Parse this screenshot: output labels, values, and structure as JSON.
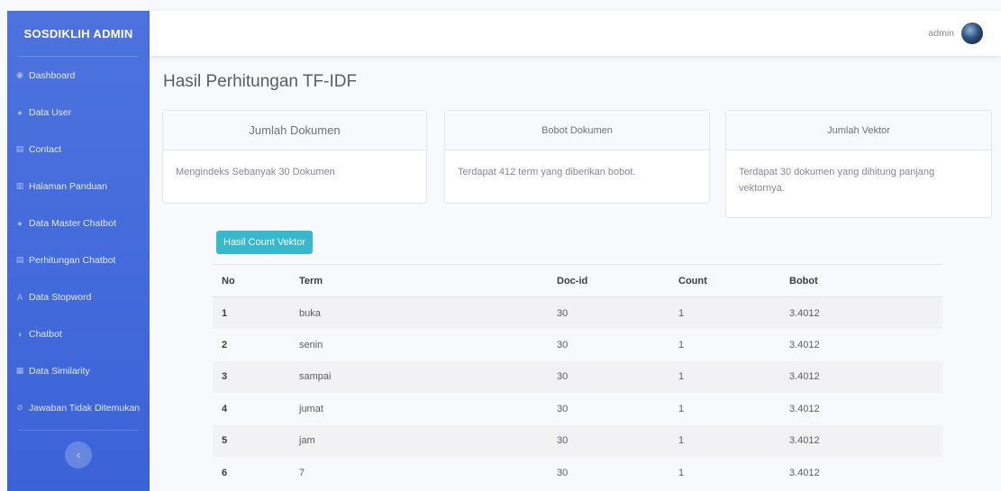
{
  "sidebar": {
    "brand": "SOSDIKLIH ADMIN",
    "items": [
      {
        "label": "Dashboard",
        "icon": "tachometer-icon",
        "glyph": "◉"
      },
      {
        "label": "Data User",
        "icon": "user-icon",
        "glyph": "●"
      },
      {
        "label": "Contact",
        "icon": "file-icon",
        "glyph": "▤"
      },
      {
        "label": "Halaman Panduan",
        "icon": "book-icon",
        "glyph": "▥"
      },
      {
        "label": "Data Master Chatbot",
        "icon": "comment-icon",
        "glyph": "●"
      },
      {
        "label": "Perhitungan Chatbot",
        "icon": "table-icon",
        "glyph": "▤"
      },
      {
        "label": "Data Stopword",
        "icon": "font-icon",
        "glyph": "A"
      },
      {
        "label": "Chatbot",
        "icon": "comments-icon",
        "glyph": "◖"
      },
      {
        "label": "Data Similarity",
        "icon": "table-icon",
        "glyph": "▦"
      },
      {
        "label": "Jawaban Tidak Ditemukan",
        "icon": "eye-slash-icon",
        "glyph": "⊘"
      }
    ],
    "toggle_glyph": "‹"
  },
  "topbar": {
    "user_name": "admin"
  },
  "page": {
    "title": "Hasil Perhitungan TF-IDF"
  },
  "cards": [
    {
      "header": "Jumlah Dokumen",
      "body": "Mengindeks Sebanyak 30 Dokumen"
    },
    {
      "header": "Bobot Dokumen",
      "body": "Terdapat 412 term yang diberikan bobot."
    },
    {
      "header": "Jumlah Vektor",
      "body": "Terdapat 30 dokumen yang dihitung panjang vektornya."
    }
  ],
  "button": {
    "label": "Hasil Count Vektor"
  },
  "table": {
    "headers": [
      "No",
      "Term",
      "Doc-id",
      "Count",
      "Bobot"
    ],
    "rows": [
      [
        "1",
        "buka",
        "30",
        "1",
        "3.4012"
      ],
      [
        "2",
        "senin",
        "30",
        "1",
        "3.4012"
      ],
      [
        "3",
        "sampai",
        "30",
        "1",
        "3.4012"
      ],
      [
        "4",
        "jumat",
        "30",
        "1",
        "3.4012"
      ],
      [
        "5",
        "jam",
        "30",
        "1",
        "3.4012"
      ],
      [
        "6",
        "7",
        "30",
        "1",
        "3.4012"
      ]
    ]
  },
  "colors": {
    "sidebar": "#4e73df",
    "info_button": "#36b9cc",
    "stripe": "#f2f2f4"
  }
}
